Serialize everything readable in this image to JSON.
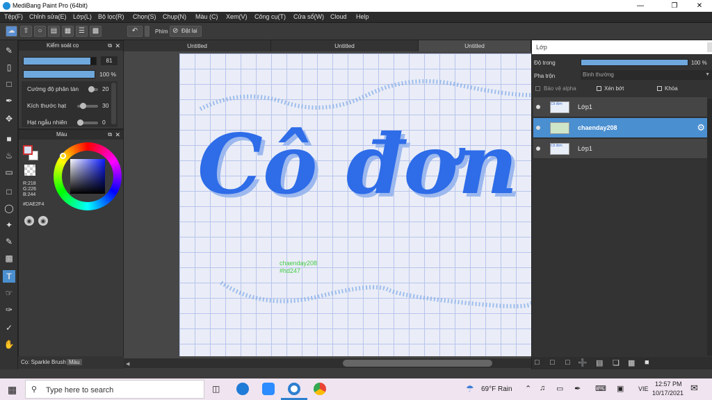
{
  "window": {
    "title": "MediBang Paint Pro (64bit)"
  },
  "menu": [
    "Tệp(F)",
    "Chỉnh sửa(E)",
    "Lớp(L)",
    "Bộ lọc(R)",
    "Chọn(S)",
    "Chụp(N)",
    "Màu (C)",
    "Xem(V)",
    "Công cụ(T)",
    "Cửa sổ(W)",
    "Cloud",
    "Help"
  ],
  "toolbar": {
    "phim_label": "Phím",
    "undo_label": "Đặt lại"
  },
  "brush_panel": {
    "title": "Kiểm soát cọ",
    "size_value": "81",
    "opacity_value": "100 %",
    "rows": [
      {
        "label": "Cường độ phân tán",
        "value": "20"
      },
      {
        "label": "Kích thước hạt",
        "value": "30"
      },
      {
        "label": "Hạt ngẫu nhiên",
        "value": "0"
      }
    ]
  },
  "color_panel": {
    "title": "Màu",
    "r": "R:218",
    "g": "G:226",
    "b": "B:244",
    "hex": "#DAE2F4"
  },
  "bottom_tabs": {
    "brush": "Cọ: Sparkle Brush",
    "color": "Màu"
  },
  "documents": [
    "Untitled",
    "Untitled",
    "Untitled"
  ],
  "canvas": {
    "main_text": "Cô đơn",
    "credit1": "chaenday208",
    "credit2": "#hd247"
  },
  "layer_panel": {
    "title": "Lớp",
    "opacity_label": "Độ trong",
    "opacity_value": "100 %",
    "blend_label": "Pha trộn",
    "blend_value": "Bình thường",
    "protect_alpha": "Bảo vệ alpha",
    "clipping": "Xén bớt",
    "lock": "Khóa",
    "layers": [
      {
        "name": "Lớp1",
        "thumb": "Cô đơn"
      },
      {
        "name": "chaenday208",
        "thumb": ""
      },
      {
        "name": "Lớp1",
        "thumb": "Cô đơn"
      }
    ]
  },
  "taskbar": {
    "search_placeholder": "Type here to search",
    "weather": "69°F  Rain",
    "lang": "VIE",
    "time": "12:57 PM",
    "date": "10/17/2021"
  },
  "colors": {
    "accent": "#4a8fd0",
    "text_blue": "#2e6ce8",
    "sparkle": "#8ab0e8",
    "credit": "#44cc44"
  }
}
